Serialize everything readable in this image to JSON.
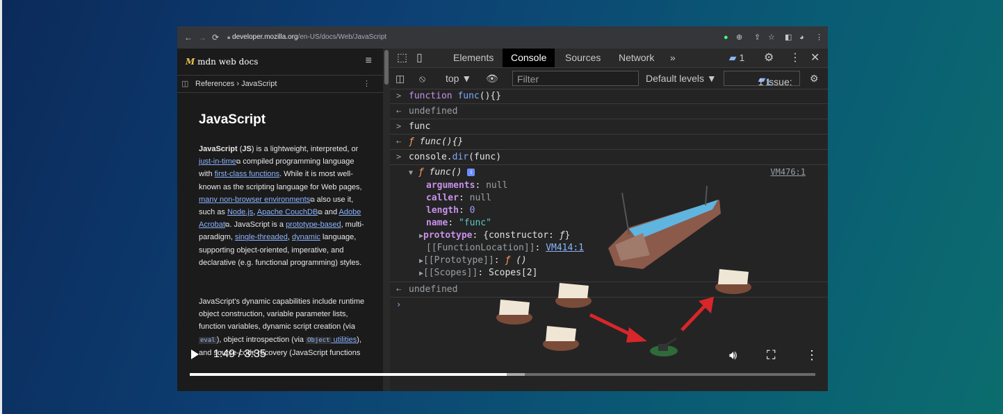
{
  "browser": {
    "url_host": "developer.mozilla.org",
    "url_path": "/en-US/docs/Web/JavaScript",
    "nav_icons": [
      "back-icon",
      "forward-icon",
      "reload-icon",
      "lock-icon"
    ]
  },
  "mdn": {
    "logo_text": "mdn web docs",
    "breadcrumb": {
      "first": "References",
      "separator": "›",
      "second": "JavaScript"
    },
    "title": "JavaScript",
    "p1": {
      "t1": "JavaScript",
      "t2": " (",
      "t3": "JS",
      "t4": ") is a lightweight, interpreted, or ",
      "l1": "just-in-time",
      "t5": " compiled programming language with ",
      "l2": "first-class functions",
      "t6": ". While it is most well-known as the scripting language for Web pages, ",
      "l3": "many non-browser environments",
      "t7": " also use it, such as ",
      "l4": "Node.js",
      "t8": ", ",
      "l5": "Apache CouchDB",
      "t9": " and ",
      "l6": "Adobe Acrobat",
      "t10": ". JavaScript is a ",
      "l7": "prototype-based",
      "t11": ", multi-paradigm, ",
      "l8": "single-threaded",
      "t12": ", ",
      "l9": "dynamic",
      "t13": " language, supporting object-oriented, imperative, and declarative (e.g. functional programming) styles."
    },
    "p2": {
      "t1": "JavaScript's dynamic capabilities include runtime object construction, variable parameter lists, function variables, dynamic script creation (via ",
      "c1": "eval",
      "t2": "), object introspection (via ",
      "c2": "Object",
      "l1": " utilities",
      "t3": "), and source-code recovery (JavaScript functions"
    }
  },
  "devtools": {
    "tabs": [
      "Elements",
      "Console",
      "Sources",
      "Network",
      "»"
    ],
    "active_tab": "Console",
    "message_badge": "1",
    "context": "top ▼",
    "filter_placeholder": "Filter",
    "levels": "Default levels ▼",
    "issues_label": "1 Issue:",
    "issues_count": "1"
  },
  "console": {
    "r1": {
      "kw": "function ",
      "fn": "func",
      "rest": "(){}"
    },
    "r2": "undefined",
    "r3": "func",
    "r4": {
      "f": "ƒ",
      "text": " func(){}"
    },
    "r5": {
      "obj": "console",
      "dot": ".",
      "method": "dir",
      "arg": "(func)"
    },
    "r6": {
      "arrow": "▼",
      "f": "ƒ",
      "text": " func()",
      "info": "i",
      "vm": "VM476:1"
    },
    "props": [
      {
        "key": "arguments",
        "sep": ": ",
        "val": "null"
      },
      {
        "key": "caller",
        "sep": ": ",
        "val": "null"
      },
      {
        "key": "length",
        "sep": ": ",
        "val": "0"
      },
      {
        "key": "name",
        "sep": ": ",
        "val": "\"func\""
      }
    ],
    "proto": {
      "arrow": "▶",
      "key": "prototype",
      "sep": ": ",
      "val": "{constructor: ",
      "f": "ƒ",
      "end": "}"
    },
    "fnloc": {
      "key": "[[FunctionLocation]]",
      "sep": ": ",
      "link": "VM414:1"
    },
    "iproto": {
      "arrow": "▶",
      "key": "[[Prototype]]",
      "sep": ": ",
      "f": "ƒ",
      "val": " ()"
    },
    "scopes": {
      "arrow": "▶",
      "key": "[[Scopes]]",
      "sep": ": ",
      "val": "Scopes[2]"
    },
    "r7": "undefined",
    "prompt": "›"
  },
  "video": {
    "time": "1:49 / 3:35",
    "progress_fraction": 0.507,
    "buffered_fraction": 0.535
  },
  "colors": {
    "accent_red_arrow": "#d8262a",
    "mdn_link": "#8cb4ff",
    "devtools_bg": "#242424"
  }
}
